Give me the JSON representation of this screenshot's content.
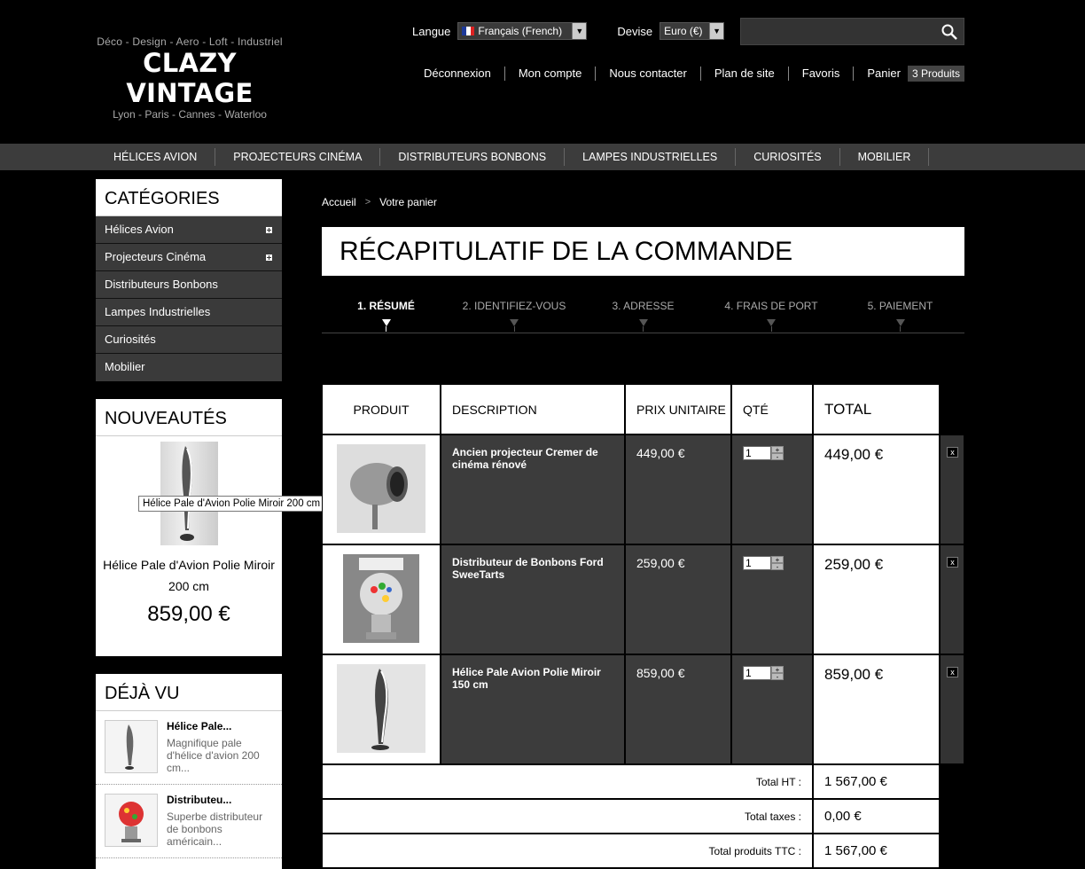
{
  "logo": {
    "tagline": "Déco - Design - Aero - Loft - Industriel",
    "name": "CLAZY VINTAGE",
    "cities": "Lyon - Paris - Cannes - Waterloo"
  },
  "header": {
    "language_label": "Langue",
    "language_value": "Français (French)",
    "currency_label": "Devise",
    "currency_value": "Euro (€)",
    "search_placeholder": "",
    "links": [
      "Déconnexion",
      "Mon compte",
      "Nous contacter",
      "Plan de site",
      "Favoris",
      "Panier"
    ],
    "cart_badge": "3 Produits"
  },
  "menu": [
    "HÉLICES AVION",
    "PROJECTEURS CINÉMA",
    "DISTRIBUTEURS BONBONS",
    "LAMPES INDUSTRIELLES",
    "CURIOSITÉS",
    "MOBILIER"
  ],
  "categories": {
    "title": "CATÉGORIES",
    "items": [
      {
        "label": "Hélices Avion",
        "expandable": true
      },
      {
        "label": "Projecteurs Cinéma",
        "expandable": true
      },
      {
        "label": "Distributeurs Bonbons",
        "expandable": false
      },
      {
        "label": "Lampes Industrielles",
        "expandable": false
      },
      {
        "label": "Curiosités",
        "expandable": false
      },
      {
        "label": "Mobilier",
        "expandable": false
      }
    ]
  },
  "new_products": {
    "title": "NOUVEAUTÉS",
    "product_name": "Hélice Pale d'Avion Polie Miroir 200 cm",
    "price": "859,00 €",
    "tooltip": "Hélice Pale d'Avion Polie Miroir 200 cm"
  },
  "viewed": {
    "title": "DÉJÀ VU",
    "items": [
      {
        "name": "Hélice Pale...",
        "desc": "Magnifique pale d'hélice d'avion 200 cm..."
      },
      {
        "name": "Distributeu...",
        "desc": "Superbe distributeur de bonbons américain..."
      }
    ]
  },
  "breadcrumb": {
    "home": "Accueil",
    "current": "Votre panier"
  },
  "page_title": "RÉCAPITULATIF DE LA COMMANDE",
  "steps": [
    "1. RÉSUMÉ",
    "2. IDENTIFIEZ-VOUS",
    "3. ADRESSE",
    "4. FRAIS DE PORT",
    "5. PAIEMENT"
  ],
  "cart": {
    "headers": {
      "product": "PRODUIT",
      "description": "DESCRIPTION",
      "unit_price": "PRIX UNITAIRE",
      "qty": "QTÉ",
      "total": "TOTAL"
    },
    "rows": [
      {
        "description": "Ancien projecteur Cremer de cinéma rénové",
        "unit_price": "449,00 €",
        "qty": "1",
        "total": "449,00 €"
      },
      {
        "description": "Distributeur de Bonbons Ford SweeTarts",
        "unit_price": "259,00 €",
        "qty": "1",
        "total": "259,00 €"
      },
      {
        "description": "Hélice Pale Avion Polie Miroir 150 cm",
        "unit_price": "859,00 €",
        "qty": "1",
        "total": "859,00 €"
      }
    ],
    "delete_label": "x",
    "totals": [
      {
        "label": "Total HT :",
        "value": "1 567,00 €"
      },
      {
        "label": "Total taxes :",
        "value": "0,00 €"
      },
      {
        "label": "Total produits TTC :",
        "value": "1 567,00 €"
      }
    ]
  }
}
